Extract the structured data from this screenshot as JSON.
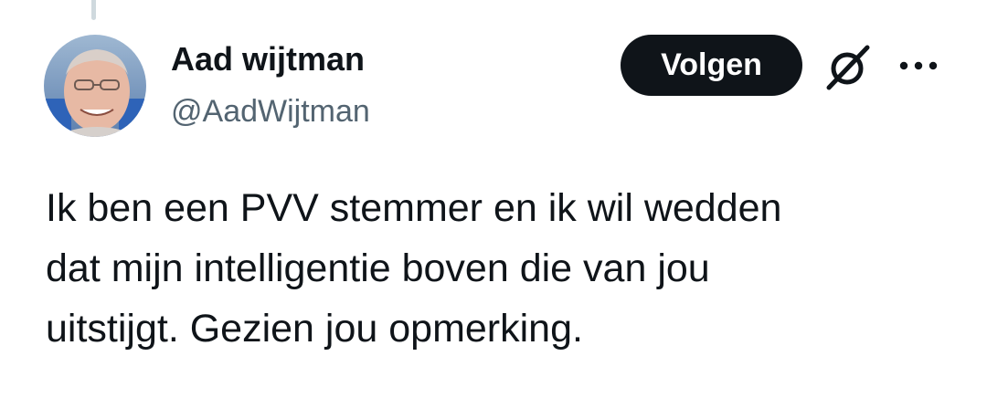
{
  "tweet": {
    "author": {
      "name": "Aad wijtman",
      "handle": "@AadWijtman",
      "avatar_icon": "profile-photo"
    },
    "follow_label": "Volgen",
    "grok_icon": "grok-icon",
    "more_icon": "more-horizontal-icon",
    "text_lines": [
      "Ik ben een PVV stemmer en ik wil wedden",
      "dat mijn intelligentie boven die van jou",
      "uitstijgt. Gezien jou opmerking."
    ]
  },
  "colors": {
    "text_primary": "#0f1419",
    "text_secondary": "#536471",
    "follow_button_bg": "#0f1419",
    "follow_button_text": "#ffffff",
    "thread_line": "#cfd9de"
  }
}
